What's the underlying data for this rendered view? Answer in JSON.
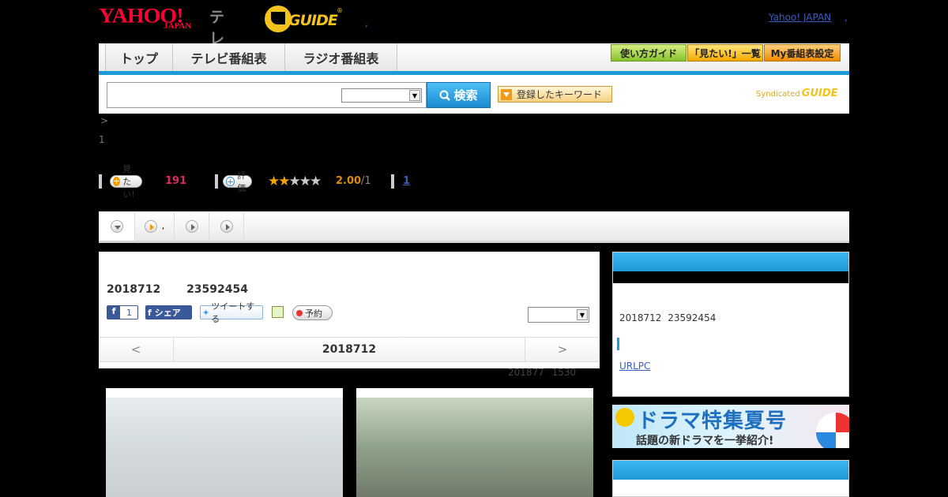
{
  "header": {
    "logo_text": "YAHOO!",
    "logo_sub": "JAPAN",
    "tv_label": "テレビ",
    "gguide_text": "GUIDE",
    "sep": ",",
    "yahoo_link": "Yahoo! JAPAN",
    "yahoo_sep": ","
  },
  "nav": {
    "tabs": [
      "トップ",
      "テレビ番組表",
      "ラジオ番組表"
    ],
    "guide": "使い方ガイド",
    "mitai_list": "「見たい!」一覧",
    "my_schedule": "My番組表設定"
  },
  "search": {
    "button": "検索",
    "keywords": "登録したキーワード",
    "syndicated": "Syndicated",
    "syndicated_logo": "GUIDE"
  },
  "breadcrumb": {
    "arrow": ">",
    "line2": "1"
  },
  "stats": {
    "mitai_label": "見たい!",
    "mitai_count": "191",
    "eval_label": "評価",
    "rating": "2.00",
    "rating_den": "/1",
    "link": "1",
    "stars": {
      "filled": 2,
      "total": 5
    }
  },
  "subtabs": {
    "second_text": ","
  },
  "program": {
    "title": "2018712 23592454",
    "fb_count": "1",
    "fb_share": "シェア",
    "tweet": "ツイートする",
    "reserve": "予約",
    "date_prev": "<",
    "date_current": "2018712",
    "date_next": ">",
    "updated": "201877 1530"
  },
  "sidebar": {
    "date_text": "2018712 23592454",
    "url_text": "URLPC"
  },
  "banner": {
    "title": "ドラマ特集夏号",
    "subtitle": "話題の新ドラマを一挙紹介!"
  },
  "colors": {
    "accent_blue": "#1e9ad8",
    "mitai_pink": "#e0285a",
    "rating_orange": "#e08a00",
    "yahoo_red": "#ff0033",
    "gguide_yellow": "#f3c21b"
  }
}
